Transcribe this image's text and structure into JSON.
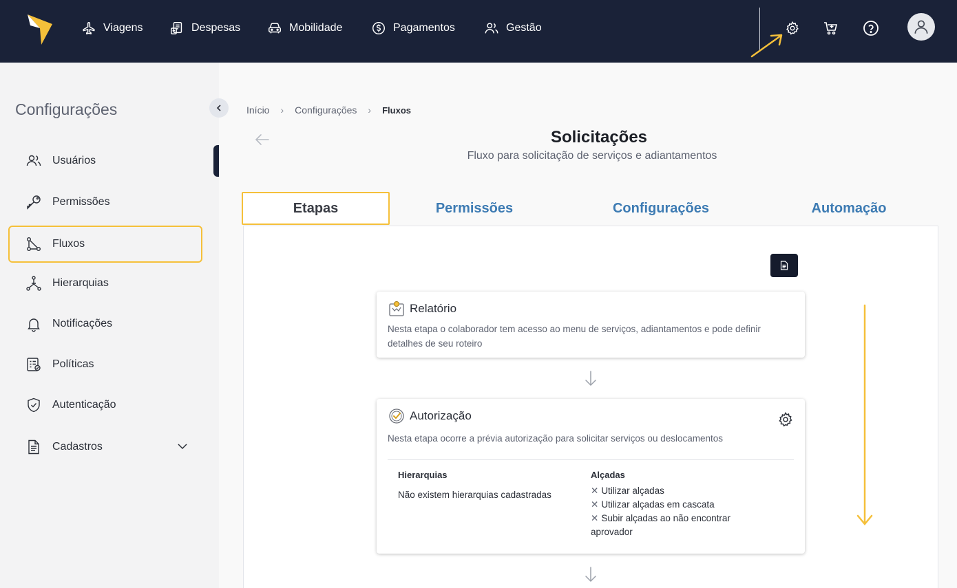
{
  "topnav": {
    "items": [
      {
        "label": "Viagens",
        "icon": "plane-icon"
      },
      {
        "label": "Despesas",
        "icon": "receipt-icon"
      },
      {
        "label": "Mobilidade",
        "icon": "car-icon"
      },
      {
        "label": "Pagamentos",
        "icon": "dollar-icon"
      },
      {
        "label": "Gestão",
        "icon": "users-icon"
      }
    ],
    "right_icons": [
      "gear-icon",
      "cart-icon",
      "help-icon",
      "avatar"
    ]
  },
  "sidebar": {
    "title": "Configurações",
    "items": [
      {
        "label": "Usuários",
        "icon": "users-icon"
      },
      {
        "label": "Permissões",
        "icon": "key-icon"
      },
      {
        "label": "Fluxos",
        "icon": "flow-icon"
      },
      {
        "label": "Hierarquias",
        "icon": "hierarchy-icon"
      },
      {
        "label": "Notificações",
        "icon": "bell-icon"
      },
      {
        "label": "Políticas",
        "icon": "policy-icon"
      },
      {
        "label": "Autenticação",
        "icon": "shield-icon"
      },
      {
        "label": "Cadastros",
        "icon": "document-icon"
      }
    ]
  },
  "breadcrumb": {
    "items": [
      "Início",
      "Configurações"
    ],
    "current": "Fluxos"
  },
  "page": {
    "title": "Solicitações",
    "subtitle": "Fluxo para solicitação de serviços e adiantamentos"
  },
  "tabs": [
    "Etapas",
    "Permissões",
    "Configurações",
    "Automação"
  ],
  "cards": {
    "relatorio": {
      "title": "Relatório",
      "description": "Nesta etapa o colaborador tem acesso ao menu de serviços, adiantamentos e pode definir detalhes de seu roteiro"
    },
    "autorizacao": {
      "title": "Autorização",
      "description": "Nesta etapa ocorre a prévia autorização para solicitar serviços ou deslocamentos",
      "hierarquias_title": "Hierarquias",
      "hierarquias_text": "Não existem hierarquias cadastradas",
      "alcadas_title": "Alçadas",
      "alcadas_items": [
        "Utilizar alçadas",
        "Utilizar alçadas em cascata",
        "Subir alçadas ao não encontrar aprovador"
      ]
    }
  },
  "colors": {
    "navbar": "#1a2238",
    "highlight": "#f5c03a",
    "tab_link": "#3d7bb3"
  }
}
